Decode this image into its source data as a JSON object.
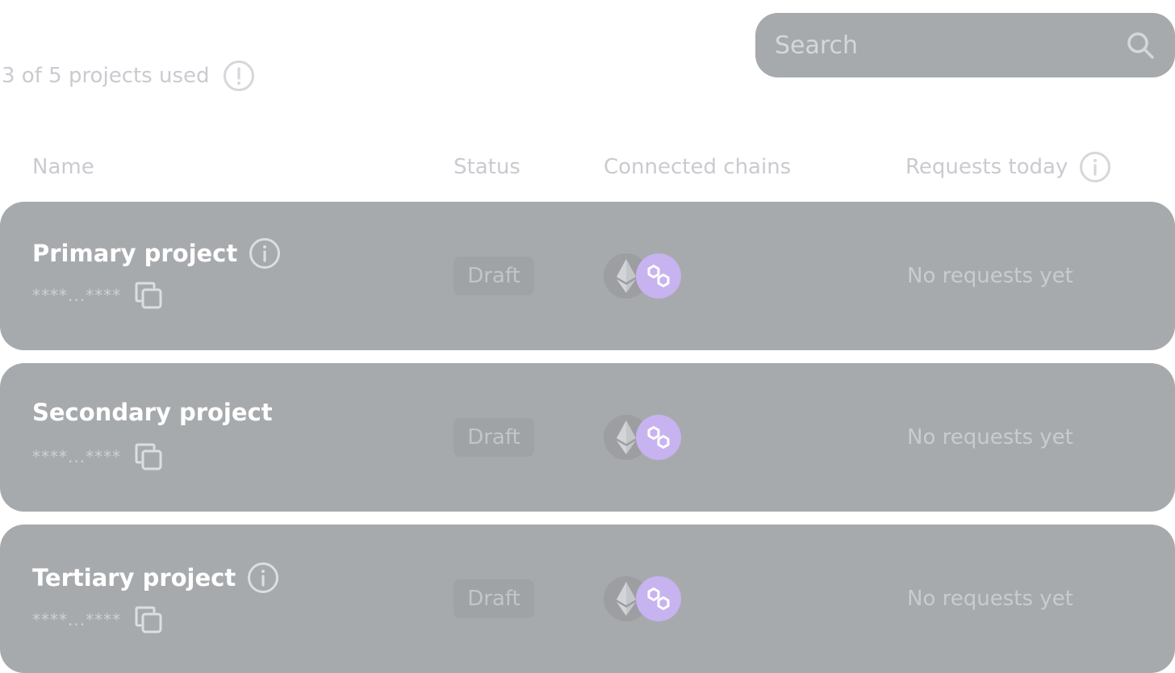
{
  "search": {
    "placeholder": "Search",
    "icon": "search-icon"
  },
  "usage": {
    "text": "3 of 5 projects used",
    "icon": "exclamation-circle-icon"
  },
  "table": {
    "headers": {
      "name": "Name",
      "status": "Status",
      "chains": "Connected chains",
      "requests": "Requests today"
    },
    "rows": [
      {
        "name": "Primary project",
        "has_info": true,
        "key": "****...****",
        "status": "Draft",
        "chains": [
          "ethereum-icon",
          "polygon-icon"
        ],
        "requests": "No requests yet"
      },
      {
        "name": "Secondary project",
        "has_info": false,
        "key": "****...****",
        "status": "Draft",
        "chains": [
          "ethereum-icon",
          "polygon-icon"
        ],
        "requests": "No requests yet"
      },
      {
        "name": "Tertiary project",
        "has_info": true,
        "key": "****...****",
        "status": "Draft",
        "chains": [
          "ethereum-icon",
          "polygon-icon"
        ],
        "requests": "No requests yet"
      }
    ]
  },
  "colors": {
    "row_background": "#a7aaad",
    "muted_text": "#c9cbd0",
    "polygon_accent": "#c7b3ef"
  }
}
